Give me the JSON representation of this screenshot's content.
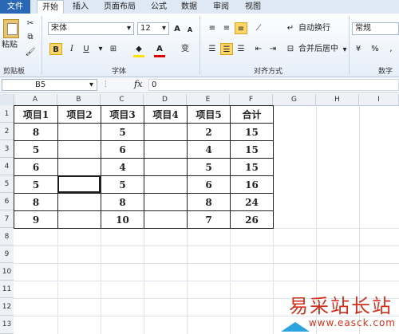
{
  "menu": {
    "file": "文件",
    "tabs": [
      "开始",
      "插入",
      "页面布局",
      "公式",
      "数据",
      "审阅",
      "视图"
    ]
  },
  "ribbon": {
    "clipboard": {
      "paste": "粘贴",
      "group": "剪贴板"
    },
    "font": {
      "name": "宋体",
      "size": "12",
      "bold": "B",
      "italic": "I",
      "underline": "U",
      "grow": "A",
      "shrink": "A",
      "color_a": "A",
      "wen": "变",
      "group": "字体"
    },
    "alignment": {
      "wrap": "自动换行",
      "merge": "合并后居中",
      "group": "对齐方式"
    },
    "number": {
      "format": "常规",
      "group": "数字"
    }
  },
  "formula_bar": {
    "name_box": "B5",
    "fx": "fx",
    "value": "0"
  },
  "columns": [
    "A",
    "B",
    "C",
    "D",
    "E",
    "F",
    "G",
    "H",
    "I"
  ],
  "rows": [
    "1",
    "2",
    "3",
    "4",
    "5",
    "6",
    "7",
    "8",
    "9",
    "10",
    "11",
    "12",
    "13"
  ],
  "sheet": {
    "header": [
      "项目1",
      "项目2",
      "项目3",
      "项目4",
      "项目5",
      "合计"
    ],
    "data": [
      [
        "8",
        "",
        "5",
        "",
        "2",
        "15"
      ],
      [
        "5",
        "",
        "6",
        "",
        "4",
        "15"
      ],
      [
        "6",
        "",
        "4",
        "",
        "5",
        "15"
      ],
      [
        "5",
        "",
        "5",
        "",
        "6",
        "16"
      ],
      [
        "8",
        "",
        "8",
        "",
        "8",
        "24"
      ],
      [
        "9",
        "",
        "10",
        "",
        "7",
        "26"
      ]
    ]
  },
  "watermark": {
    "text": "易采站长站",
    "url": "www.easck.com",
    "color": "#d2301d"
  }
}
